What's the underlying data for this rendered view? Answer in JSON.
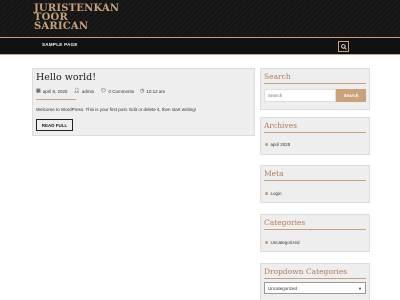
{
  "site": {
    "title_line1": "JURISTENKAN",
    "title_line2": "TOOR",
    "title_line3": "SARICAN"
  },
  "nav": {
    "items": [
      "SAMPLE PAGE"
    ],
    "search_icon": "search-icon"
  },
  "post": {
    "title": "Hello world!",
    "date": "april 8, 2025",
    "author": "admin",
    "comments": "0 Comments",
    "time": "10:12 am",
    "excerpt": "Welcome to WordPress. This is your first post. Edit or delete it, then start writing!",
    "read_more": "READ FULL"
  },
  "sidebar": {
    "search": {
      "title": "Search",
      "placeholder": "Search",
      "button": "Search"
    },
    "archives": {
      "title": "Archives",
      "items": [
        "april 2025"
      ]
    },
    "meta": {
      "title": "Meta",
      "items": [
        "Login"
      ]
    },
    "categories": {
      "title": "Categories",
      "items": [
        "Uncategorized"
      ]
    },
    "dropdown_categories": {
      "title": "Dropdown Categories",
      "selected": "Uncategorized"
    }
  },
  "colors": {
    "accent": "#c9a27a",
    "header_bg": "#151515"
  }
}
